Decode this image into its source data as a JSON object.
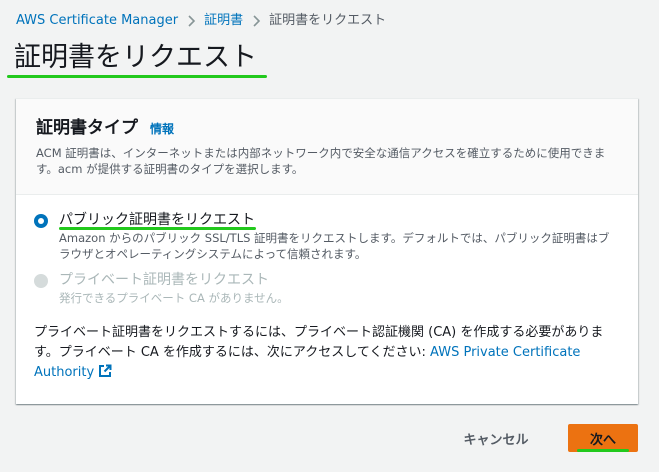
{
  "breadcrumb": {
    "items": [
      {
        "label": "AWS Certificate Manager"
      },
      {
        "label": "証明書"
      },
      {
        "label": "証明書をリクエスト"
      }
    ],
    "separator_icon": "chevron-right-icon"
  },
  "page": {
    "title": "証明書をリクエスト"
  },
  "certificate_type": {
    "title": "証明書タイプ",
    "info_label": "情報",
    "description": "ACM 証明書は、インターネットまたは内部ネットワーク内で安全な通信アクセスを確立するために使用できます。acm が提供する証明書のタイプを選択します。",
    "options": [
      {
        "label": "パブリック証明書をリクエスト",
        "description": "Amazon からのパブリック SSL/TLS 証明書をリクエストします。デフォルトでは、パブリック証明書はブラウザとオペレーティングシステムによって信頼されます。",
        "selected": true,
        "disabled": false
      },
      {
        "label": "プライベート証明書をリクエスト",
        "description": "発行できるプライベート CA がありません。",
        "selected": false,
        "disabled": true
      }
    ],
    "private_note": "プライベート証明書をリクエストするには、プライベート認証機関 (CA) を作成する必要があります。プライベート CA を作成するには、次にアクセスしてください: ",
    "private_link": "AWS Private Certificate Authority",
    "external_link_icon": "external-link-icon"
  },
  "actions": {
    "cancel_label": "キャンセル",
    "next_label": "次へ"
  },
  "colors": {
    "link": "#0073bb",
    "primary_button": "#ec7211",
    "highlight": "#22c91c",
    "background": "#f2f3f3"
  }
}
